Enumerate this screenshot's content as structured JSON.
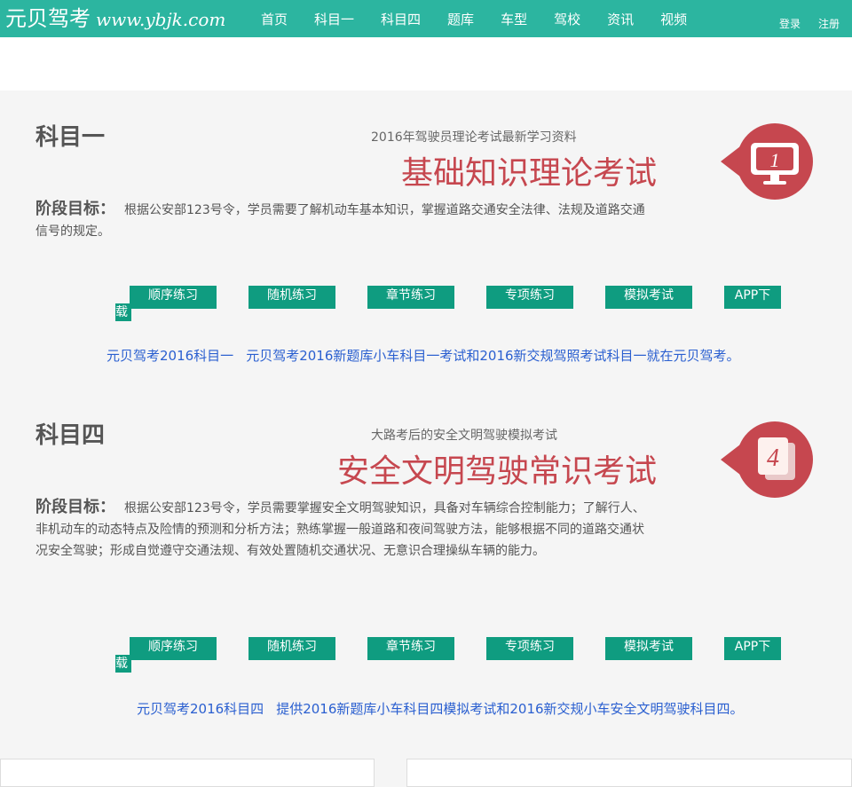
{
  "header": {
    "logo_cn": "元贝驾考",
    "logo_url": "www.ybjk.com",
    "nav": [
      "首页",
      "科目一",
      "科目四",
      "题库",
      "车型",
      "驾校",
      "资讯",
      "视频"
    ],
    "login": "登录",
    "register": "注册"
  },
  "sections": [
    {
      "title": "科目一",
      "subtitle": "2016年驾驶员理论考试最新学习资料",
      "headline": "基础知识理论考试",
      "badge_number": "1",
      "goal_label": "阶段目标：",
      "goal_text": "根据公安部123号令，学员需要了解机动车基本知识，掌握道路交通安全法律、法规及道路交通信号的规定。",
      "buttons": [
        "顺序练习",
        "随机练习",
        "章节练习",
        "专项练习",
        "模拟考试"
      ],
      "app_button_top": "APP下",
      "app_button_bottom": "载",
      "links": [
        "元贝驾考2016科目一",
        "元贝驾考2016新题库小车科目一考试和2016新交规驾照考试科目一就在元贝驾考。"
      ]
    },
    {
      "title": "科目四",
      "subtitle": "大路考后的安全文明驾驶模拟考试",
      "headline": "安全文明驾驶常识考试",
      "badge_number": "4",
      "goal_label": "阶段目标：",
      "goal_text": "根据公安部123号令，学员需要掌握安全文明驾驶知识，具备对车辆综合控制能力；了解行人、非机动车的动态特点及险情的预测和分析方法；熟练掌握一般道路和夜间驾驶方法，能够根据不同的道路交通状况安全驾驶；形成自觉遵守交通法规、有效处置随机交通状况、无意识合理操纵车辆的能力。",
      "buttons": [
        "顺序练习",
        "随机练习",
        "章节练习",
        "专项练习",
        "模拟考试"
      ],
      "app_button_top": "APP下",
      "app_button_bottom": "载",
      "links": [
        "元贝驾考2016科目四",
        "提供2016新题库小车科目四模拟考试和2016新交规小车安全文明驾驶科目四。"
      ]
    }
  ],
  "colors": {
    "header": "#2cb5a0",
    "button": "#0f9c80",
    "accent": "#c6474f",
    "link": "#2a5fd0"
  }
}
